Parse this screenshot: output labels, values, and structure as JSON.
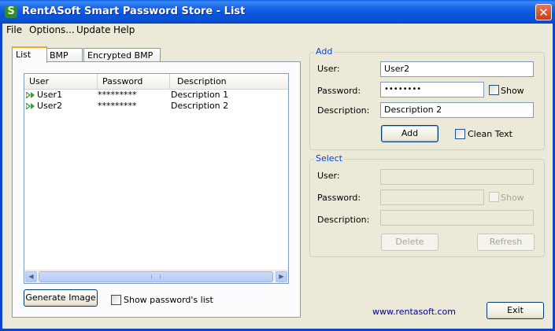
{
  "window": {
    "title": "RentASoft Smart Password Store - List",
    "close_glyph": "✕",
    "app_icon_glyph": "S"
  },
  "menu": {
    "file": "File",
    "options": "Options...",
    "update": "Update",
    "help": "Help"
  },
  "tabs": [
    {
      "label": "List",
      "active": true
    },
    {
      "label": "BMP list",
      "active": false
    },
    {
      "label": "Encrypted BMP list",
      "active": false
    }
  ],
  "list": {
    "columns": [
      "User",
      "Password",
      "Description"
    ],
    "rows": [
      {
        "user": "User1",
        "password": "*********",
        "description": "Description 1"
      },
      {
        "user": "User2",
        "password": "*********",
        "description": "Description 2"
      }
    ]
  },
  "bottom": {
    "generate_button": "Generate Image",
    "show_passwords_label": "Show password's list",
    "show_passwords_checked": false
  },
  "add": {
    "title": "Add",
    "user_label": "User:",
    "user_value": "User2",
    "password_label": "Password:",
    "password_value": "••••••••",
    "show_label": "Show",
    "show_checked": false,
    "description_label": "Description:",
    "description_value": "Description 2",
    "add_button": "Add",
    "clean_text_label": "Clean Text",
    "clean_text_checked": false
  },
  "select": {
    "title": "Select",
    "user_label": "User:",
    "user_value": "",
    "password_label": "Password:",
    "password_value": "",
    "show_label": "Show",
    "description_label": "Description:",
    "description_value": "",
    "delete_button": "Delete",
    "refresh_button": "Refresh"
  },
  "footer": {
    "website": "www.rentasoft.com",
    "exit_button": "Exit"
  },
  "colors": {
    "accent_title": "#0046d5",
    "row_arrow": "#2fa32f",
    "link": "#00008b"
  },
  "icons": {
    "row_marker": "double-arrow-right-icon",
    "scroll_left": "scroll-left-icon",
    "scroll_right": "scroll-right-icon"
  }
}
